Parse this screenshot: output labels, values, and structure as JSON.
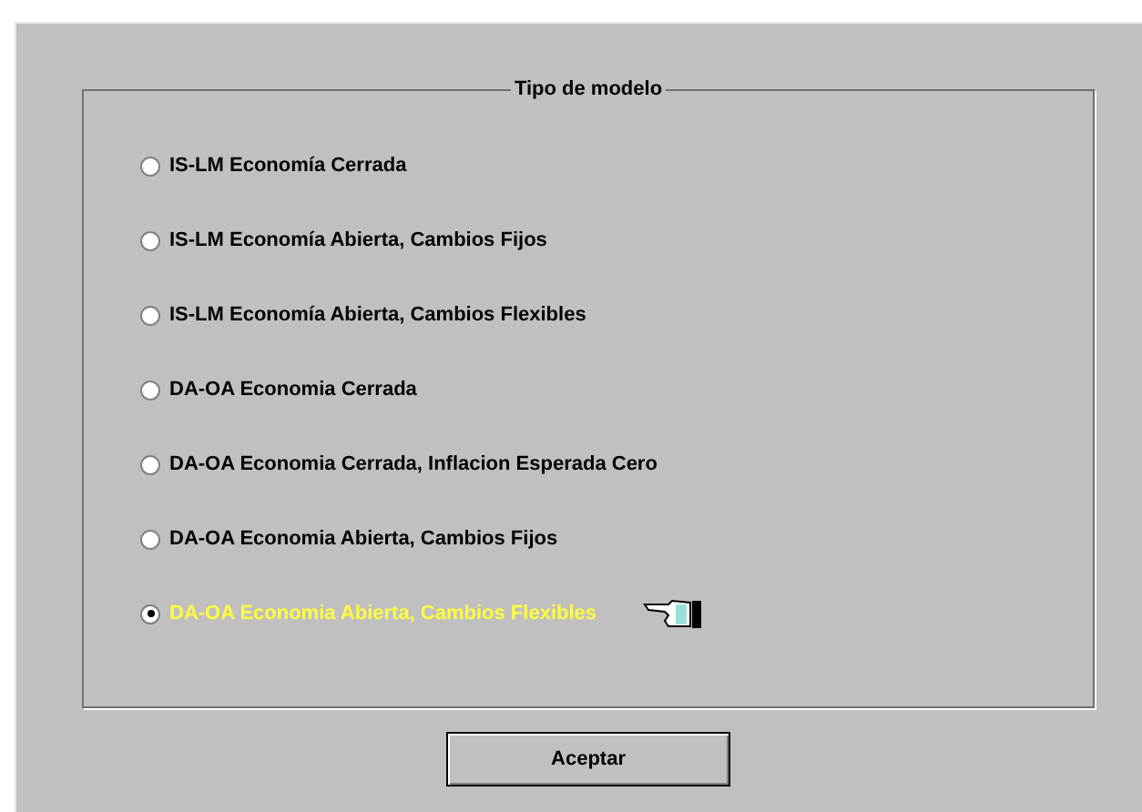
{
  "group": {
    "title": "Tipo de modelo"
  },
  "options": [
    {
      "label": "IS-LM Economía Cerrada",
      "selected": false
    },
    {
      "label": "IS-LM Economía Abierta, Cambios Fijos",
      "selected": false
    },
    {
      "label": "IS-LM Economía Abierta, Cambios Flexibles",
      "selected": false
    },
    {
      "label": "DA-OA Economia Cerrada",
      "selected": false
    },
    {
      "label": "DA-OA Economia Cerrada, Inflacion Esperada Cero",
      "selected": false
    },
    {
      "label": "DA-OA Economia Abierta, Cambios Fijos",
      "selected": false
    },
    {
      "label": "DA-OA Economia Abierta, Cambios Flexibles",
      "selected": true
    }
  ],
  "buttons": [
    "Aceptar"
  ]
}
